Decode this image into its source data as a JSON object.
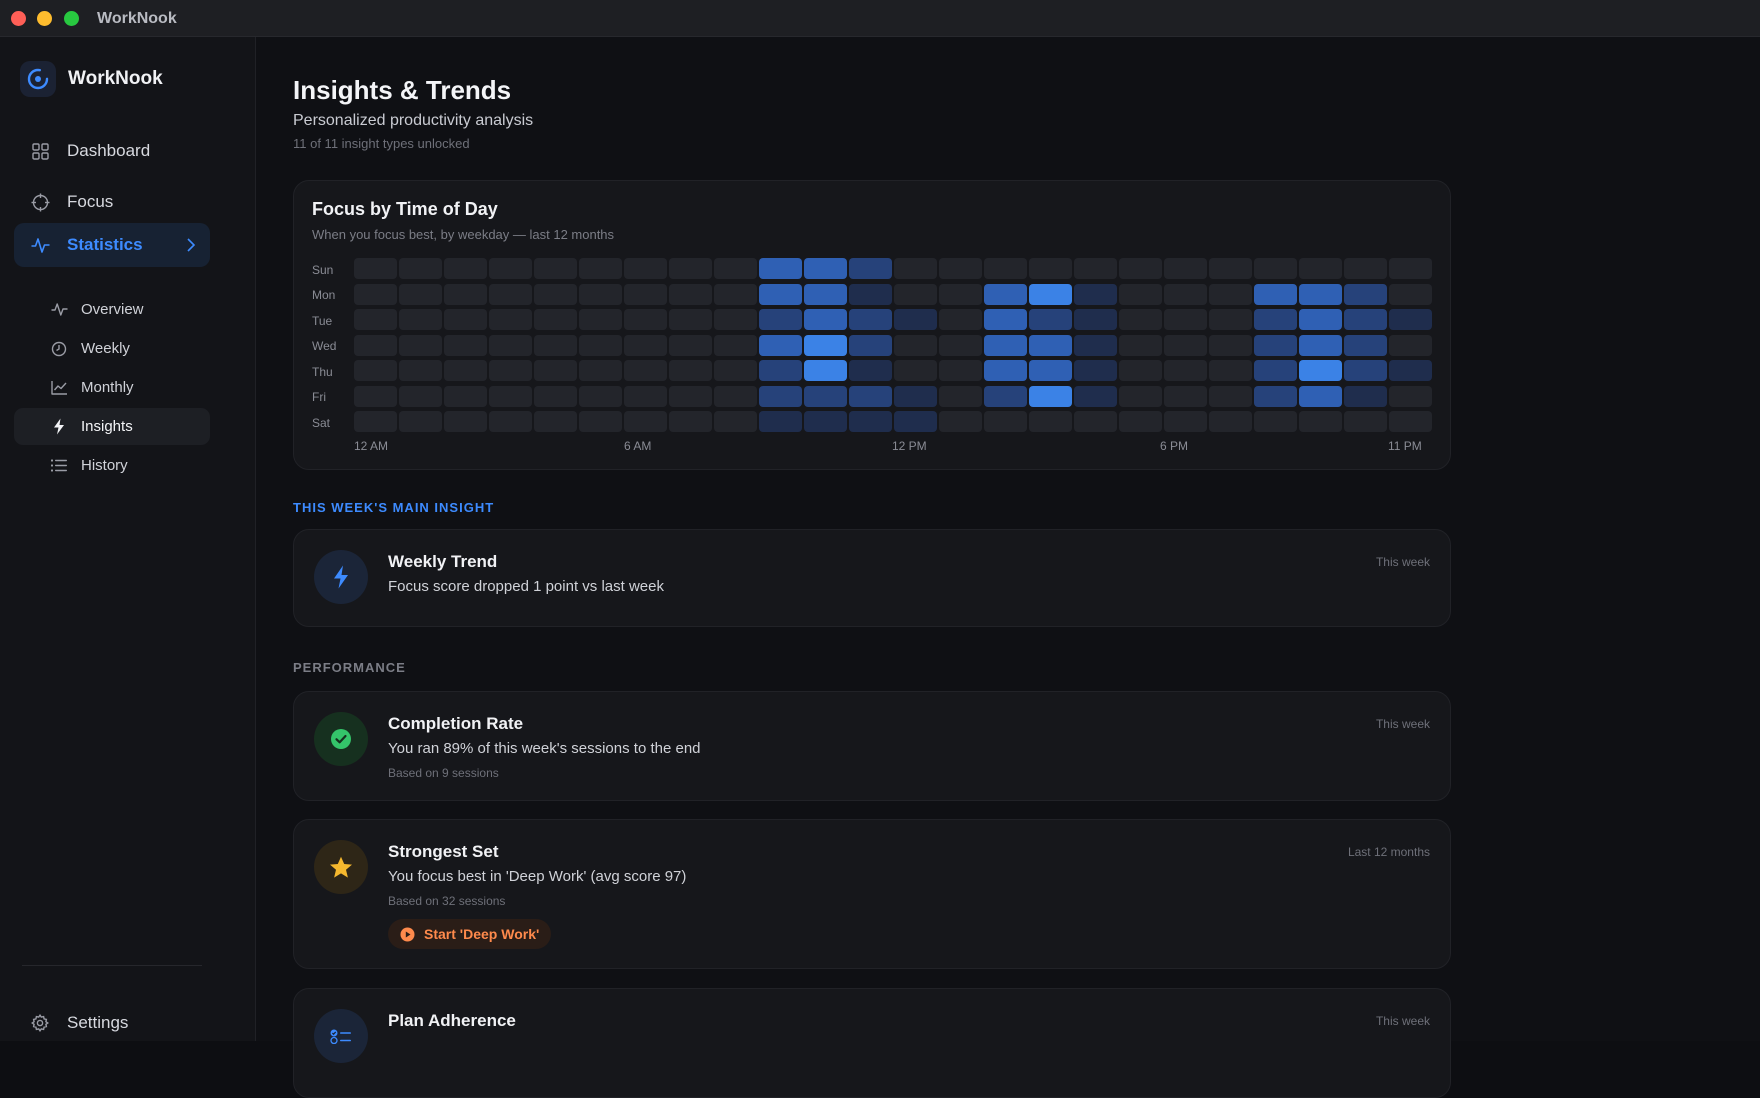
{
  "window": {
    "title": "WorkNook"
  },
  "sidebar": {
    "brand": "WorkNook",
    "items": [
      {
        "label": "Dashboard",
        "icon": "grid-icon"
      },
      {
        "label": "Focus",
        "icon": "crosshair-icon"
      },
      {
        "label": "Statistics",
        "icon": "pulse-icon",
        "active": true
      }
    ],
    "subitems": [
      {
        "label": "Overview",
        "icon": "pulse-icon"
      },
      {
        "label": "Weekly",
        "icon": "clock-icon"
      },
      {
        "label": "Monthly",
        "icon": "line-chart-icon"
      },
      {
        "label": "Insights",
        "icon": "bolt-icon",
        "active": true
      },
      {
        "label": "History",
        "icon": "list-icon"
      }
    ],
    "settings": "Settings"
  },
  "header": {
    "title": "Insights & Trends",
    "subtitle": "Personalized productivity analysis",
    "meta": "11 of 11 insight types unlocked"
  },
  "heatmap": {
    "title": "Focus by Time of Day",
    "subtitle": "When you focus best, by weekday — last 12 months",
    "days": [
      "Sun",
      "Mon",
      "Tue",
      "Wed",
      "Thu",
      "Fri",
      "Sat"
    ],
    "x_labels": [
      "12 AM",
      "6 AM",
      "12 PM",
      "6 PM",
      "11 PM"
    ],
    "levels": [
      [
        0,
        0,
        0,
        0,
        0,
        0,
        0,
        0,
        0,
        3,
        3,
        2,
        0,
        0,
        0,
        0,
        0,
        0,
        0,
        0,
        0,
        0,
        0,
        0
      ],
      [
        0,
        0,
        0,
        0,
        0,
        0,
        0,
        0,
        0,
        3,
        3,
        1,
        0,
        0,
        3,
        4,
        1,
        0,
        0,
        0,
        3,
        3,
        2,
        0
      ],
      [
        0,
        0,
        0,
        0,
        0,
        0,
        0,
        0,
        0,
        2,
        3,
        2,
        1,
        0,
        3,
        2,
        1,
        0,
        0,
        0,
        2,
        3,
        2,
        1
      ],
      [
        0,
        0,
        0,
        0,
        0,
        0,
        0,
        0,
        0,
        3,
        4,
        2,
        0,
        0,
        3,
        3,
        1,
        0,
        0,
        0,
        2,
        3,
        2,
        0
      ],
      [
        0,
        0,
        0,
        0,
        0,
        0,
        0,
        0,
        0,
        2,
        4,
        1,
        0,
        0,
        3,
        3,
        1,
        0,
        0,
        0,
        2,
        4,
        2,
        1
      ],
      [
        0,
        0,
        0,
        0,
        0,
        0,
        0,
        0,
        0,
        2,
        2,
        2,
        1,
        0,
        2,
        4,
        1,
        0,
        0,
        0,
        2,
        3,
        1,
        0
      ],
      [
        0,
        0,
        0,
        0,
        0,
        0,
        0,
        0,
        0,
        1,
        1,
        1,
        1,
        0,
        0,
        0,
        0,
        0,
        0,
        0,
        0,
        0,
        0,
        0
      ]
    ],
    "colors": [
      "#23252b",
      "#1f2d4d",
      "#26427a",
      "#2f60b4",
      "#3b82e6"
    ]
  },
  "main_insight": {
    "section": "THIS WEEK'S MAIN INSIGHT",
    "title": "Weekly Trend",
    "desc": "Focus score dropped 1 point vs last week",
    "period": "This week",
    "icon": "bolt-icon"
  },
  "performance": {
    "section": "PERFORMANCE",
    "cards": [
      {
        "title": "Completion Rate",
        "desc": "You ran 89% of this week's sessions to the end",
        "based": "Based on 9 sessions",
        "period": "This week",
        "icon": "check-circle-icon"
      },
      {
        "title": "Strongest Set",
        "desc": "You focus best in 'Deep Work' (avg score 97)",
        "based": "Based on 32 sessions",
        "period": "Last 12 months",
        "icon": "star-icon",
        "action": "Start 'Deep Work'"
      },
      {
        "title": "Plan Adherence",
        "desc": "",
        "based": "",
        "period": "This week",
        "icon": "checklist-icon"
      }
    ]
  },
  "colors": {
    "accent": "#3d8bff",
    "section_accent": "#3d8bff",
    "success": "#34c46a",
    "star": "#f5b82e",
    "action": "#ff8a4c"
  }
}
